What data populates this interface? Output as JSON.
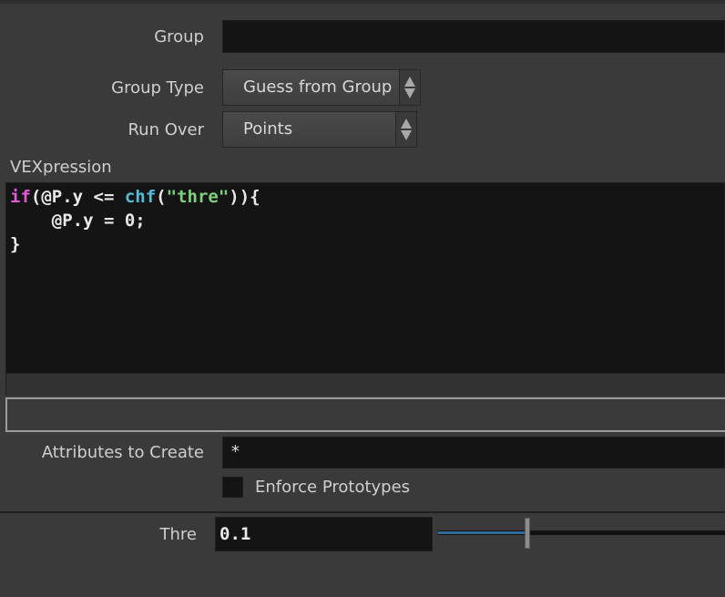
{
  "group": {
    "label": "Group",
    "value": ""
  },
  "group_type": {
    "label": "Group Type",
    "value": "Guess from Group"
  },
  "run_over": {
    "label": "Run Over",
    "value": "Points"
  },
  "vexpression": {
    "label": "VEXpression",
    "lines": [
      {
        "kw": "if",
        "a": "(@P.y <= ",
        "fn": "chf",
        "b": "(",
        "str": "\"thre\"",
        "c": ")){"
      },
      {
        "text": "    @P.y = 0;"
      },
      {
        "text": "}"
      }
    ]
  },
  "attributes": {
    "label": "Attributes to Create",
    "value": "*"
  },
  "enforce_prototypes": {
    "label": "Enforce Prototypes",
    "checked": false
  },
  "thre": {
    "label": "Thre",
    "value": "0.1",
    "slider_fraction": 0.31
  }
}
